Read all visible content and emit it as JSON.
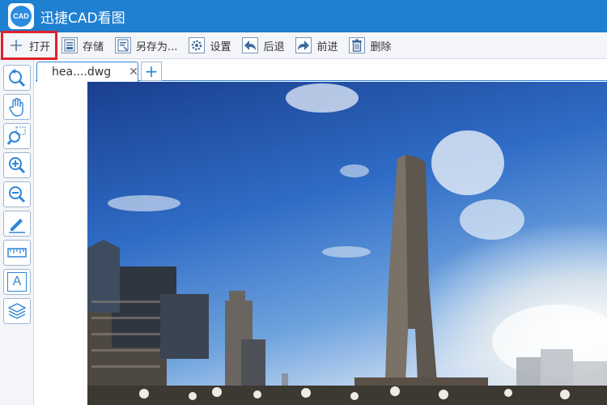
{
  "app": {
    "title": "迅捷CAD看图",
    "logo_text": "CAD"
  },
  "toolbar": {
    "open": "打开",
    "save": "存储",
    "save_as": "另存为...",
    "settings": "设置",
    "back": "后退",
    "forward": "前进",
    "delete": "删除"
  },
  "tabs": {
    "file_name": "hea....dwg",
    "close": "✕",
    "add": "+"
  },
  "sidebar": {
    "tools": [
      "undo-view",
      "pan",
      "zoom-window",
      "zoom-in",
      "zoom-out",
      "annotate",
      "measure",
      "text",
      "layers"
    ],
    "text_tool_glyph": "A"
  },
  "colors": {
    "titlebar": "#1f7fd1",
    "accent": "#2f86d6",
    "highlight": "#e0202a"
  }
}
